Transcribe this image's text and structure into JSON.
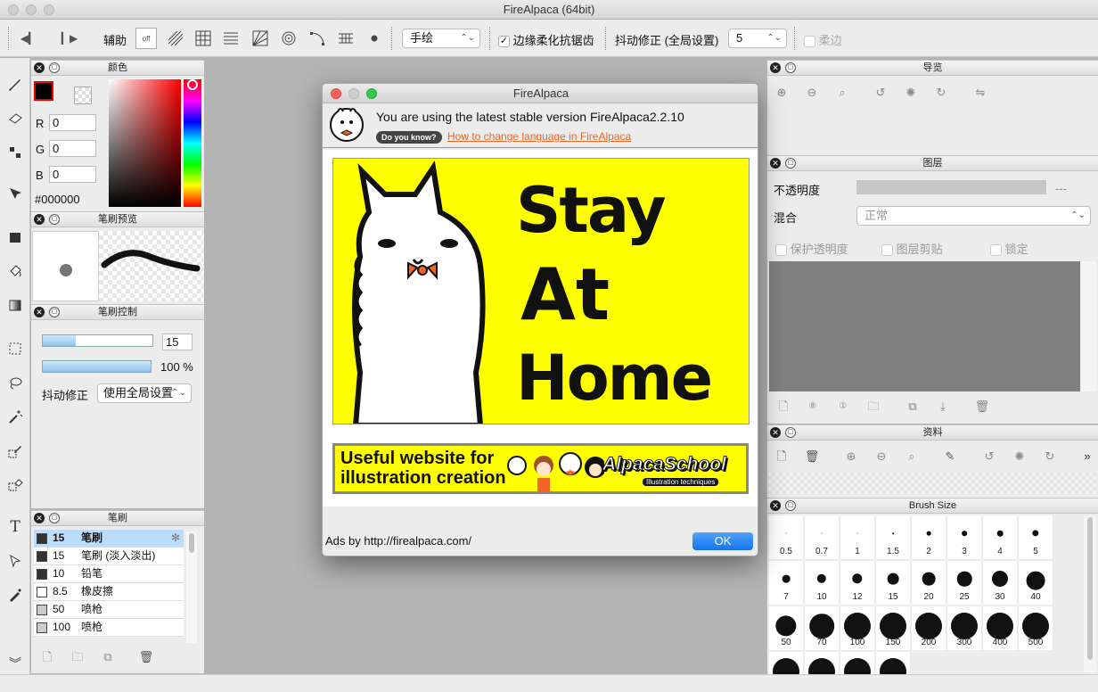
{
  "window": {
    "title": "FireAlpaca (64bit)"
  },
  "toolbar": {
    "assist_label": "辅助",
    "snap_off_label": "off",
    "draw_mode": "手绘",
    "antialias_label": "边缘柔化抗锯齿",
    "antialias_checked": true,
    "stabilizer_label": "抖动修正 (全局设置)",
    "stabilizer_value": "5",
    "soft_edge_label": "柔边"
  },
  "color_panel": {
    "title": "颜色",
    "r_label": "R",
    "r_value": "0",
    "g_label": "G",
    "g_value": "0",
    "b_label": "B",
    "b_value": "0",
    "hex": "#000000",
    "primary_color": "#000000"
  },
  "brush_preview": {
    "title": "笔刷预览"
  },
  "brush_control": {
    "title": "笔刷控制",
    "size_value": "15",
    "opacity_value": "100 %",
    "stabilizer_label": "抖动修正",
    "stabilizer_option": "使用全局设置"
  },
  "brush_panel": {
    "title": "笔刷",
    "items": [
      {
        "size": "15",
        "name": "笔刷",
        "color": "#333333",
        "selected": true
      },
      {
        "size": "15",
        "name": "笔刷 (淡入淡出)",
        "color": "#333333"
      },
      {
        "size": "10",
        "name": "铅笔",
        "color": "#333333"
      },
      {
        "size": "8.5",
        "name": "橡皮擦",
        "color": "#ffffff"
      },
      {
        "size": "50",
        "name": "喷枪",
        "color": "#cccccc"
      },
      {
        "size": "100",
        "name": "喷枪",
        "color": "#cccccc"
      }
    ]
  },
  "navigator": {
    "title": "导览"
  },
  "layer_panel": {
    "title": "图层",
    "opacity_label": "不透明度",
    "opacity_value": "---",
    "blend_label": "混合",
    "blend_value": "正常",
    "protect_alpha_label": "保护透明度",
    "clipping_label": "图层剪贴",
    "lock_label": "锁定"
  },
  "material_panel": {
    "title": "资料"
  },
  "brush_size_panel": {
    "title": "Brush Size",
    "sizes": [
      "0.5",
      "0.7",
      "1",
      "1.5",
      "2",
      "3",
      "4",
      "5",
      "7",
      "10",
      "12",
      "15",
      "20",
      "25",
      "30",
      "40",
      "50",
      "70",
      "100",
      "150",
      "200",
      "300",
      "400",
      "500",
      "",
      "",
      "",
      ""
    ]
  },
  "dialog": {
    "title": "FireAlpaca",
    "version_text": "You are using the latest stable version FireAlpaca2.2.10",
    "tip_badge": "Do you know?",
    "tip_link": "How to change language in FireAlpaca",
    "banner_words": [
      "Stay",
      "At",
      "Home"
    ],
    "ad_text_line1": "Useful website for",
    "ad_text_line2": "illustration creation",
    "ad_brand": "AlpacaSchool",
    "ad_brand_sub": "Illustration techniques",
    "ads_by": "Ads by http://firealpaca.com/",
    "ok_label": "OK"
  }
}
